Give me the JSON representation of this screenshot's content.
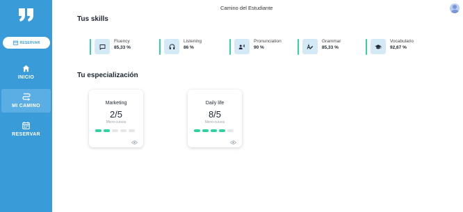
{
  "header": {
    "title": "Camino del Estudiante"
  },
  "sidebar": {
    "reserve_button": "RESERVAR",
    "items": [
      {
        "label": "INICIO",
        "icon": "home-icon"
      },
      {
        "label": "MI CAMINO",
        "icon": "route-icon",
        "active": true
      },
      {
        "label": "RESERVAR",
        "icon": "calendar-icon"
      }
    ]
  },
  "skills": {
    "title": "Tus skills",
    "items": [
      {
        "name": "Fluency",
        "value": "85,33 %",
        "icon": "chat-bubble-icon"
      },
      {
        "name": "Listening",
        "value": "86 %",
        "icon": "headphones-icon"
      },
      {
        "name": "Pronunciation",
        "value": "90 %",
        "icon": "speaking-person-icon"
      },
      {
        "name": "Grammar",
        "value": "85,33 %",
        "icon": "grammar-edit-icon"
      },
      {
        "name": "Vocabulario",
        "value": "92,67 %",
        "icon": "graduation-cap-icon"
      }
    ]
  },
  "specialization": {
    "title": "Tu especialización",
    "cards": [
      {
        "name": "Marketing",
        "progress": "2/5",
        "subtitle": "Micro-cursos",
        "completed": 2,
        "total": 5
      },
      {
        "name": "Daily life",
        "progress": "8/5",
        "subtitle": "Micro-cursos",
        "completed": 4,
        "total": 5
      }
    ]
  },
  "colors": {
    "sidebar": "#3a9bd9",
    "accent": "#2fd3a0",
    "icon_bg": "#d4e9f6"
  }
}
